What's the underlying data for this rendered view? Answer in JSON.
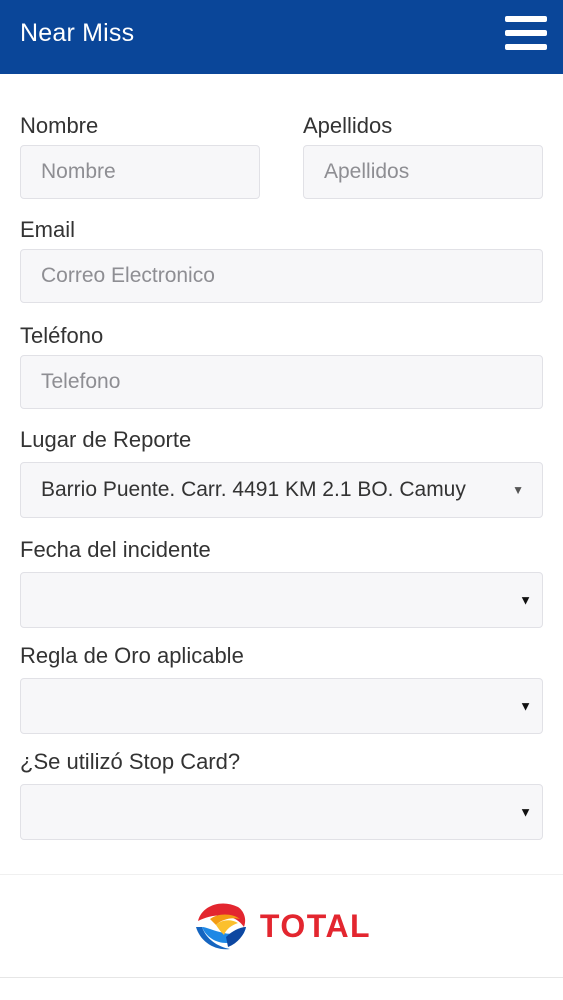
{
  "header": {
    "title": "Near Miss",
    "menu_icon": "hamburger-menu-icon"
  },
  "form": {
    "first_name": {
      "label": "Nombre",
      "placeholder": "Nombre",
      "value": ""
    },
    "last_name": {
      "label": "Apellidos",
      "placeholder": "Apellidos",
      "value": ""
    },
    "email": {
      "label": "Email",
      "placeholder": "Correo Electronico",
      "value": ""
    },
    "phone": {
      "label": "Teléfono",
      "placeholder": "Telefono",
      "value": ""
    },
    "location": {
      "label": "Lugar de Reporte",
      "selected": "Barrio Puente. Carr. 4491 KM 2.1 BO. Camuy"
    },
    "incident_date": {
      "label": "Fecha del incidente",
      "selected": ""
    },
    "golden_rule": {
      "label": "Regla de Oro aplicable",
      "selected": ""
    },
    "stop_card": {
      "label": "¿Se utilizó Stop Card?",
      "selected": ""
    }
  },
  "footer": {
    "brand": "TOTAL",
    "logo_icon": "total-logo-icon"
  },
  "colors": {
    "header_bg": "#0a4699",
    "brand_red": "#e3262f",
    "field_bg": "#f7f7f9"
  }
}
